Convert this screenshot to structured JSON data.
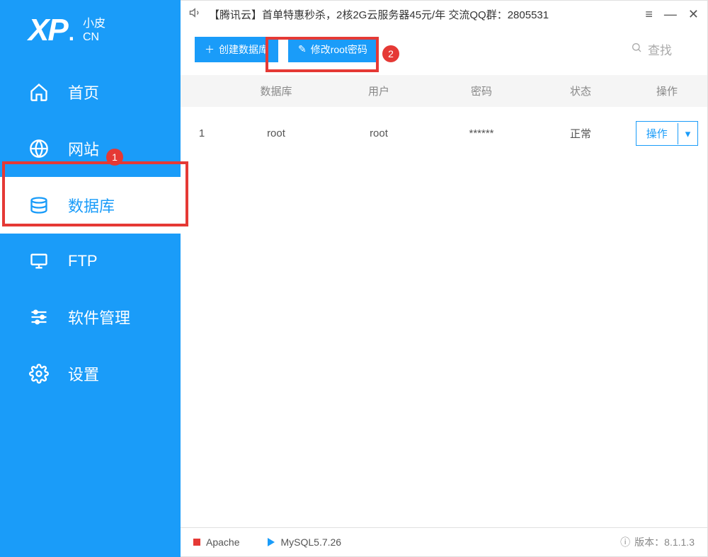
{
  "logo": {
    "xp": "XP",
    "dot": ".",
    "small": "小皮",
    "cn": "CN"
  },
  "sidebar": {
    "items": [
      {
        "label": "首页"
      },
      {
        "label": "网站"
      },
      {
        "label": "数据库"
      },
      {
        "label": "FTP"
      },
      {
        "label": "软件管理"
      },
      {
        "label": "设置"
      }
    ]
  },
  "annotations": {
    "badge1": "1",
    "badge2": "2"
  },
  "titlebar": {
    "text": "【腾讯云】首单特惠秒杀，2核2G云服务器45元/年 交流QQ群：2805531"
  },
  "toolbar": {
    "create_db": "创建数据库",
    "change_root": "修改root密码",
    "search": "查找"
  },
  "table": {
    "headers": {
      "db": "数据库",
      "user": "用户",
      "pass": "密码",
      "status": "状态",
      "action": "操作"
    },
    "rows": [
      {
        "idx": "1",
        "db": "root",
        "user": "root",
        "pass": "******",
        "status": "正常",
        "action": "操作"
      }
    ]
  },
  "statusbar": {
    "apache": "Apache",
    "mysql": "MySQL5.7.26",
    "version_label": "版本：",
    "version": "8.1.1.3"
  }
}
